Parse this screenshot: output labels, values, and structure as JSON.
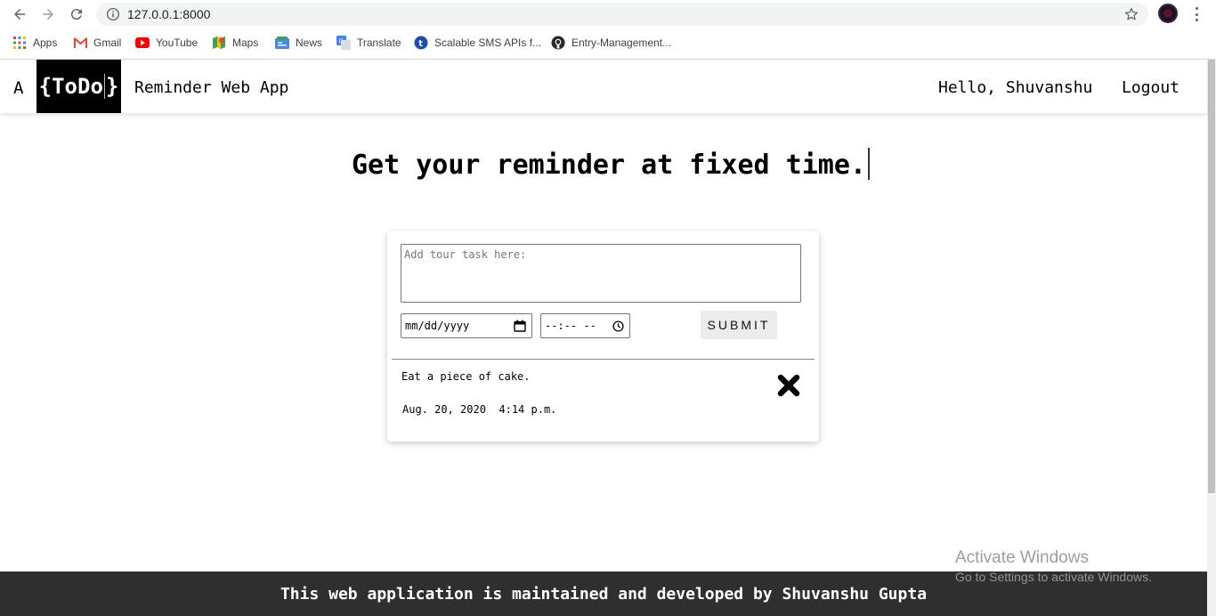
{
  "browser": {
    "url": "127.0.0.1:8000",
    "bookmarks": [
      {
        "label": "Apps",
        "icon": "apps-grid-icon"
      },
      {
        "label": "Gmail",
        "icon": "gmail-icon"
      },
      {
        "label": "YouTube",
        "icon": "youtube-icon"
      },
      {
        "label": "Maps",
        "icon": "maps-icon"
      },
      {
        "label": "News",
        "icon": "news-icon"
      },
      {
        "label": "Translate",
        "icon": "translate-icon"
      },
      {
        "label": "Scalable SMS APIs f...",
        "icon": "twilio-icon"
      },
      {
        "label": "Entry-Management...",
        "icon": "github-icon"
      }
    ]
  },
  "header": {
    "brand_prefix": "A",
    "brand_left": "{ToDo",
    "brand_right": "}",
    "brand_title": "Reminder Web App",
    "greeting": "Hello, Shuvanshu",
    "logout_label": "Logout"
  },
  "main": {
    "headline": "Get your reminder at fixed time."
  },
  "form": {
    "task_placeholder": "Add tour task here:",
    "date_value": "mm/dd/yyyy",
    "time_value": "--:-- --",
    "submit_label": "SUBMIT"
  },
  "tasks": [
    {
      "text": "Eat a piece of cake.",
      "date": "Aug. 20, 2020",
      "time": "4:14 p.m."
    }
  ],
  "footer": {
    "text": "This web application is maintained and developed by Shuvanshu Gupta"
  },
  "watermark": {
    "title": "Activate Windows",
    "subtitle": "Go to Settings to activate Windows."
  },
  "colors": {
    "footer_bg": "#2f2f2f",
    "brand_bg": "#000000",
    "submit_bg": "#ececec"
  }
}
